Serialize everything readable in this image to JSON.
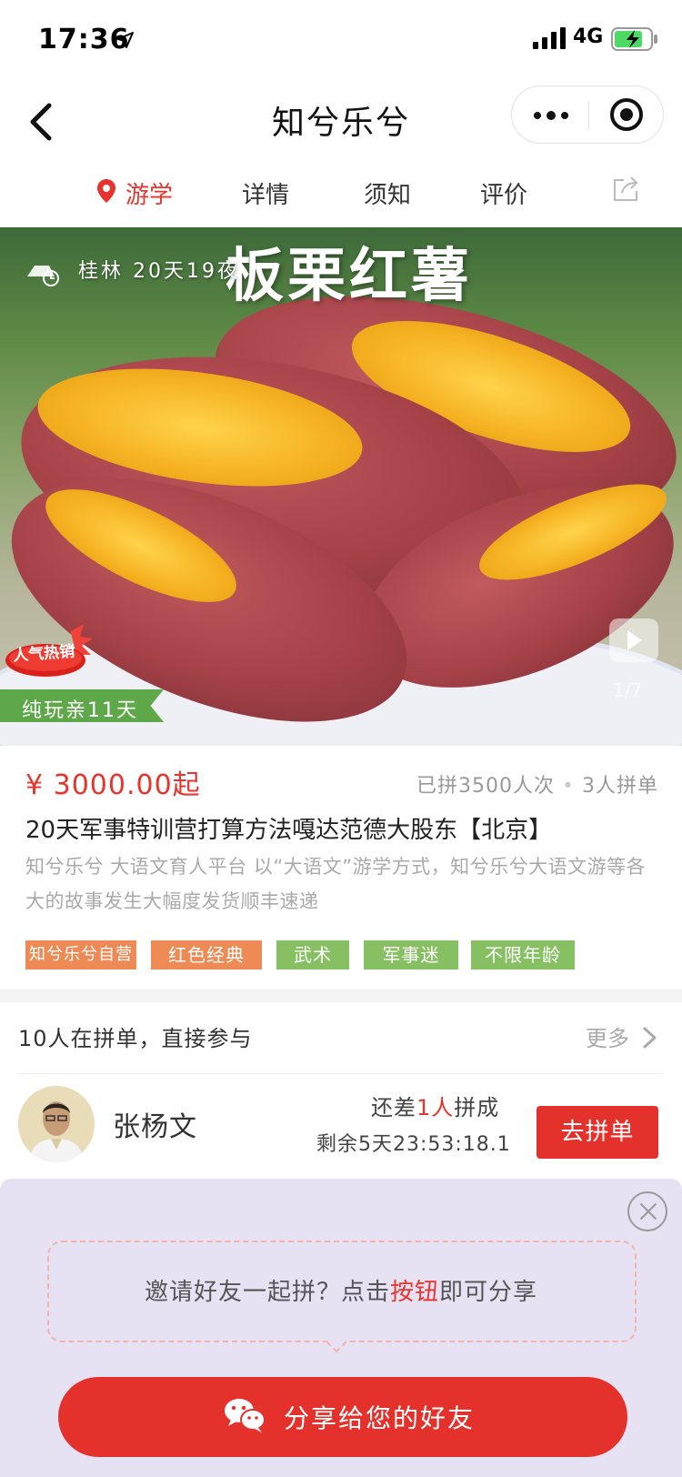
{
  "status_bar": {
    "time": "17:36",
    "network": "4G",
    "icons": [
      "location-arrow-icon",
      "signal-icon",
      "battery-charging-icon"
    ]
  },
  "nav": {
    "title": "知兮乐兮",
    "icons": [
      "back-icon",
      "more-icon",
      "close-miniprogram-icon"
    ]
  },
  "tabs": [
    {
      "label": "游学",
      "active": true
    },
    {
      "label": "详情",
      "active": false
    },
    {
      "label": "须知",
      "active": false
    },
    {
      "label": "评价",
      "active": false
    }
  ],
  "hero": {
    "title": "板栗红薯",
    "meta": "桂林  20天19夜",
    "badge": "人气热销",
    "ribbon": "纯玩亲11天",
    "pager": "1/7"
  },
  "product": {
    "price": "¥ 3000.00起",
    "sold": "已拼3500人次",
    "sold_sep": "•",
    "group_size": "3人拼单",
    "title": "20天军事特训营打算方法嘎达范德大股东【北京】",
    "desc": "知兮乐兮 大语文育人平台 以“大语文”游学方式，知兮乐兮大语文游等各大的故事发生大幅度发货顺丰速递",
    "tags": [
      {
        "label": "知兮乐兮自营",
        "color": "#ee8a55"
      },
      {
        "label": "红色经典",
        "color": "#ee8a55"
      },
      {
        "label": "武术",
        "color": "#87c062"
      },
      {
        "label": "军事迷",
        "color": "#87c062"
      },
      {
        "label": "不限年龄",
        "color": "#87c062"
      }
    ]
  },
  "group_buy": {
    "header": "10人在拼单，直接参与",
    "more": "更多",
    "member": {
      "name": "张杨文",
      "need_prefix": "还差",
      "need_num": "1",
      "need_unit": "人",
      "need_suffix": "拼成",
      "countdown": "剩余5天23:53:18.1",
      "button": "去拼单"
    }
  },
  "share_panel": {
    "tip_prefix": "邀请好友一起拼？点击",
    "tip_highlight": "按钮",
    "tip_suffix": "即可分享",
    "button": "分享给您的好友"
  },
  "colors": {
    "accent": "#e4312b",
    "tag_orange": "#ee8a55",
    "tag_green": "#87c062",
    "overlay_bg": "#e6e2f4"
  }
}
